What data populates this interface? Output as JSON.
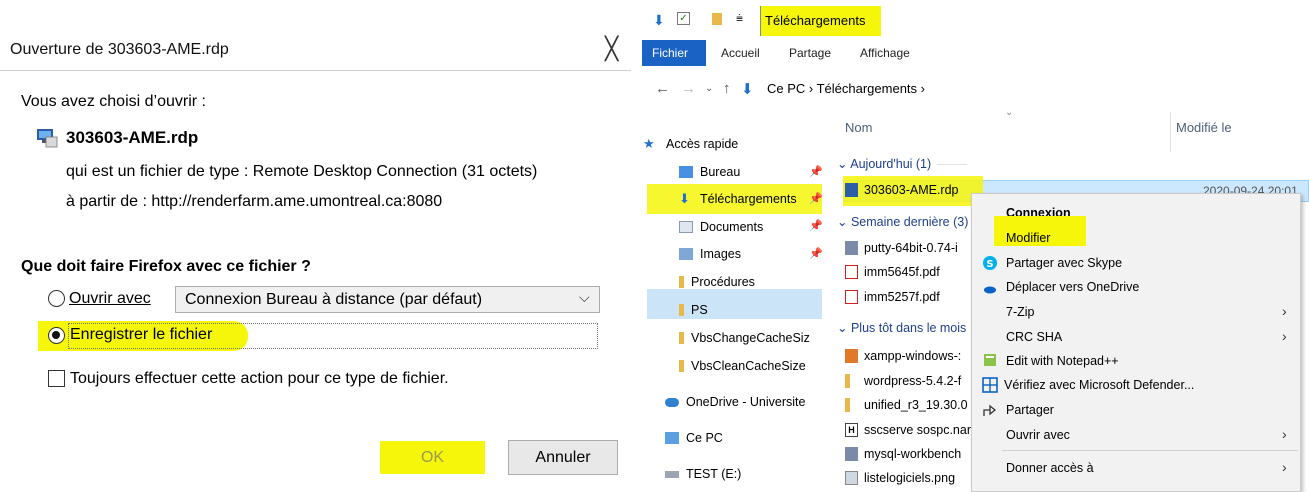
{
  "dialog": {
    "title": "Ouverture de 303603-AME.rdp",
    "close_glyph": "╳",
    "chosen_label": "Vous avez choisi d’ouvrir :",
    "file_name": "303603-AME.rdp",
    "file_icon": "remote-desktop-icon",
    "file_type_line": "qui est un fichier de type : Remote Desktop Connection (31 octets)",
    "file_from_line": "à partir de : http://renderfarm.ame.umontreal.ca:8080",
    "question": "Que doit faire Firefox avec ce fichier ?",
    "open_with_label": "Ouvrir avec",
    "open_with_value": "Connexion Bureau à distance (par défaut)",
    "save_label": "Enregistrer le fichier",
    "always_label": "Toujours effectuer cette action pour ce type de fichier.",
    "ok_label": "OK",
    "cancel_label": "Annuler",
    "selected_option": "save",
    "always_checked": false
  },
  "explorer": {
    "window_title": "Téléchargements",
    "ribbon_tabs": [
      "Fichier",
      "Accueil",
      "Partage",
      "Affichage"
    ],
    "address": "Ce PC  ›  Téléchargements  ›",
    "nav": {
      "quick_access": "Accès rapide",
      "items": [
        "Bureau",
        "Téléchargements",
        "Documents",
        "Images",
        "Procédures",
        "PS",
        "VbsChangeCacheSiz",
        "VbsCleanCacheSize"
      ],
      "onedrive": "OneDrive - Universite",
      "this_pc": "Ce PC",
      "drive": "TEST (E:)"
    },
    "columns": {
      "name": "Nom",
      "modified": "Modifié le"
    },
    "groups": {
      "today": "Aujourd'hui (1)",
      "last_week": "Semaine dernière (3)",
      "earlier": "Plus tôt dans le mois"
    },
    "files": {
      "selected": "303603-AME.rdp",
      "selected_date": "2020-09-24 20:01",
      "week": [
        "putty-64bit-0.74-i",
        "imm5645f.pdf",
        "imm5257f.pdf"
      ],
      "month": [
        "xampp-windows-:",
        "wordpress-5.4.2-f",
        "unified_r3_19.30.0",
        "sscserve sospc.nar",
        "mysql-workbench",
        "listelogiciels.png"
      ]
    },
    "context_menu": {
      "items": [
        "Connexion",
        "Modifier",
        "Partager avec Skype",
        "Déplacer vers OneDrive",
        "7-Zip",
        "CRC SHA",
        "Edit with Notepad++",
        "Vérifiez avec Microsoft Defender...",
        "Partager",
        "Ouvrir avec",
        "Donner accès à"
      ]
    }
  },
  "colors": {
    "highlight": "#f6f60a",
    "ribbon_blue": "#1a63c4",
    "selection": "#cce8ff"
  }
}
